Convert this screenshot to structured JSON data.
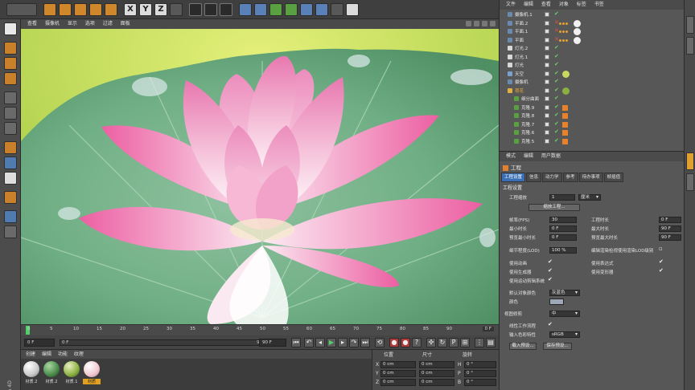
{
  "toolbar": {
    "axis_x": "X",
    "axis_y": "Y",
    "axis_z": "Z"
  },
  "viewport": {
    "menu": [
      "查看",
      "摄像机",
      "显示",
      "选项",
      "过滤",
      "面板"
    ]
  },
  "timeline": {
    "ticks": [
      "0",
      "5",
      "10",
      "15",
      "20",
      "25",
      "30",
      "35",
      "40",
      "45",
      "50",
      "55",
      "60",
      "65",
      "70",
      "75",
      "80",
      "85",
      "90"
    ],
    "end_label": "0 F"
  },
  "transport": {
    "current_frame": "0 F",
    "slider_start": "0 F",
    "slider_end": "90 F",
    "max_frame": "90 F"
  },
  "material_manager": {
    "menu": [
      "创建",
      "编辑",
      "功能",
      "纹理"
    ],
    "materials": [
      {
        "label": "材质.2",
        "color": "#e8e8e8"
      },
      {
        "label": "材质.2",
        "color": "#4a8a4a"
      },
      {
        "label": "材质.1",
        "color": "#8ab040"
      },
      {
        "label": "材质",
        "color": "#f0c8d0"
      }
    ]
  },
  "coordinates": {
    "headers": [
      "位置",
      "尺寸",
      "旋转"
    ],
    "rows": [
      {
        "axis": "X",
        "pos": "0 cm",
        "size": "0 cm",
        "rot_axis": "H",
        "rot": "0 °"
      },
      {
        "axis": "Y",
        "pos": "0 cm",
        "size": "0 cm",
        "rot_axis": "P",
        "rot": "0 °"
      },
      {
        "axis": "Z",
        "pos": "0 cm",
        "size": "0 cm",
        "rot_axis": "B",
        "rot": "0 °"
      }
    ]
  },
  "object_manager": {
    "menu": [
      "文件",
      "编辑",
      "查看",
      "对象",
      "标签",
      "书签"
    ],
    "objects": [
      {
        "name": "摄像机.1",
        "highlight": false
      },
      {
        "name": "平面.2",
        "highlight": false
      },
      {
        "name": "平面.1",
        "highlight": false
      },
      {
        "name": "平面",
        "highlight": false
      },
      {
        "name": "灯光.2",
        "highlight": false
      },
      {
        "name": "灯光.1",
        "highlight": false
      },
      {
        "name": "灯光",
        "highlight": false
      },
      {
        "name": "天空",
        "highlight": false
      },
      {
        "name": "摄像机",
        "highlight": false
      },
      {
        "name": "荷花",
        "highlight": true
      },
      {
        "name": "细分曲面",
        "highlight": false
      },
      {
        "name": "克隆.9",
        "highlight": false
      },
      {
        "name": "克隆.8",
        "highlight": false
      },
      {
        "name": "克隆.7",
        "highlight": false
      },
      {
        "name": "克隆.6",
        "highlight": false
      },
      {
        "name": "克隆.5",
        "highlight": false
      }
    ]
  },
  "attribute_manager": {
    "menu": [
      "模式",
      "编辑",
      "用户数据"
    ],
    "title": "工程",
    "tabs": [
      "工程设置",
      "信息",
      "动力学",
      "参考",
      "待办事项",
      "帧插值"
    ],
    "section": "工程设置",
    "scale_label": "工程缩放",
    "scale_value": "1",
    "scale_unit": "厘米",
    "scale_button": "缩放工程...",
    "fps_label": "帧率(FPS)",
    "fps_value": "30",
    "min_time_label": "最小时长",
    "min_time_value": "0 F",
    "preview_min_label": "预览最小时长",
    "preview_min_value": "0 F",
    "lod_label": "细节程度(LOD)",
    "lod_value": "100 %",
    "project_time_label": "工程时长",
    "project_time_value": "0 F",
    "max_time_label": "最大时长",
    "max_time_value": "90 F",
    "preview_max_label": "预览最大时长",
    "preview_max_value": "90 F",
    "render_lod_label": "编辑渲染检视使用渲染LOD级别",
    "checks_left": [
      "使用动画",
      "使用生成器",
      "使用运动剪辑系统"
    ],
    "checks_right": [
      "使用表达式",
      "使用变形器"
    ],
    "default_color_label": "默认对象颜色",
    "default_color_value": "灰蓝色",
    "color_label": "颜色",
    "view_clip_label": "视图修剪",
    "view_clip_value": "中",
    "linear_flow_label": "线性工作流程",
    "input_color_label": "输入色彩特性",
    "input_color_value": "sRGB",
    "load_preset_button": "载入预设...",
    "save_preset_button": "保存预设..."
  }
}
